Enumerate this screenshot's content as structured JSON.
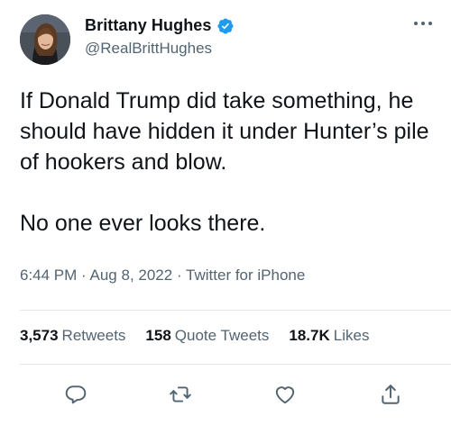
{
  "user": {
    "display_name": "Brittany Hughes",
    "handle": "@RealBrittHughes",
    "verified": true
  },
  "tweet": {
    "text_paragraphs": [
      "If Donald Trump did take something, he should have hidden it under Hunter’s pile of hookers and blow.",
      "No one ever looks there."
    ],
    "time": "6:44 PM",
    "separator": "·",
    "date": "Aug 8, 2022",
    "source": "Twitter for iPhone"
  },
  "stats": {
    "retweets": {
      "count": "3,573",
      "label": "Retweets"
    },
    "quote_tweets": {
      "count": "158",
      "label": "Quote Tweets"
    },
    "likes": {
      "count": "18.7K",
      "label": "Likes"
    }
  },
  "colors": {
    "text_primary": "#0f1419",
    "text_secondary": "#536471",
    "verified_blue": "#1d9bf0",
    "divider": "#e4e8eb"
  },
  "icons": {
    "more": "more-horizontal-icon",
    "reply": "reply-icon",
    "retweet": "retweet-icon",
    "like": "heart-icon",
    "share": "share-icon"
  }
}
